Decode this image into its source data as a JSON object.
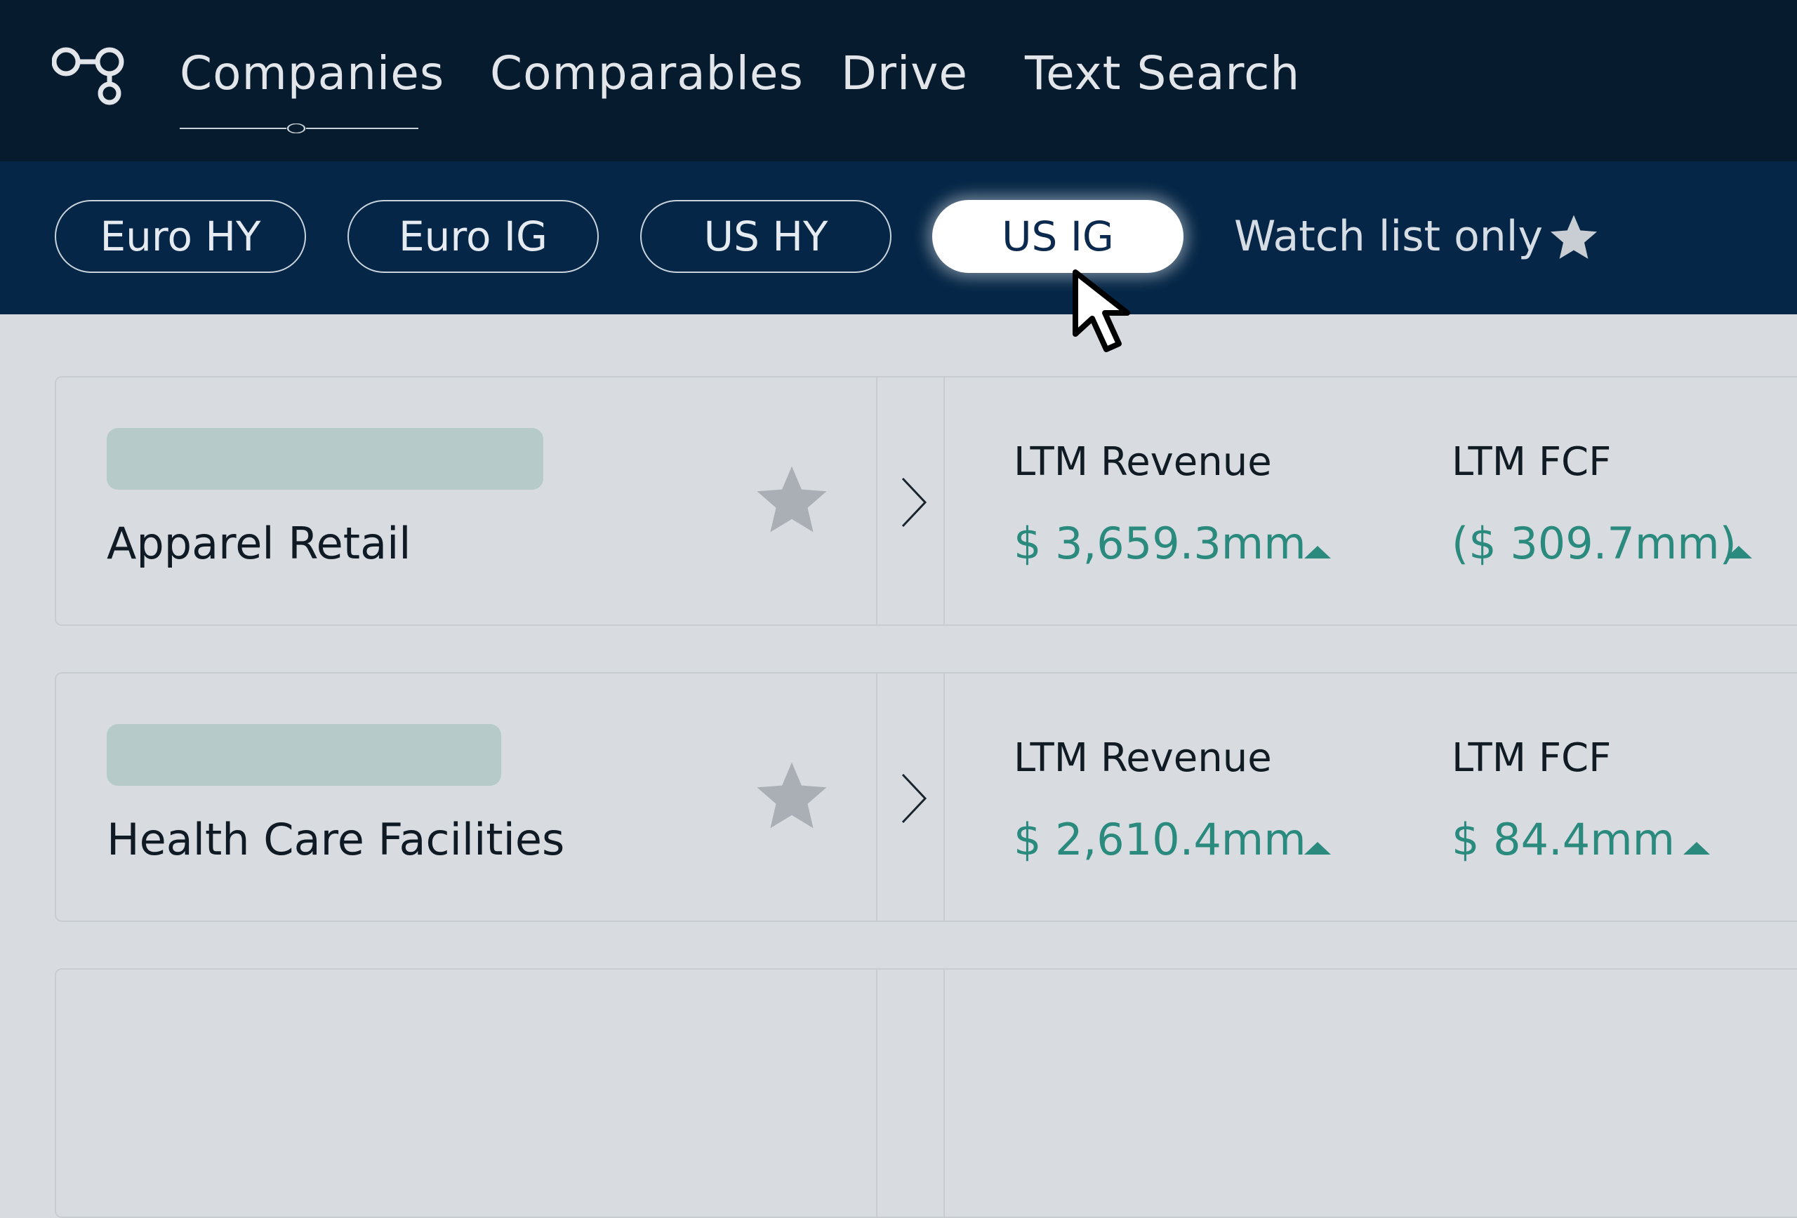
{
  "nav": {
    "items": [
      {
        "label": "Companies",
        "active": true
      },
      {
        "label": "Comparables",
        "active": false
      },
      {
        "label": "Drive",
        "active": false
      },
      {
        "label": "Text Search",
        "active": false
      }
    ]
  },
  "filters": {
    "pills": [
      {
        "label": "Euro HY",
        "active": false
      },
      {
        "label": "Euro IG",
        "active": false
      },
      {
        "label": "US HY",
        "active": false
      },
      {
        "label": "US IG",
        "active": true
      }
    ],
    "watch_list_label": "Watch list only",
    "watch_list_icon": "star-icon"
  },
  "companies": [
    {
      "sector": "Apparel Retail",
      "metrics": [
        {
          "label": "LTM Revenue",
          "value": "$ 3,659.3mm",
          "trend": "up"
        },
        {
          "label": "LTM FCF",
          "value": "($ 309.7mm)",
          "trend": "up"
        }
      ]
    },
    {
      "sector": "Health Care Facilities",
      "metrics": [
        {
          "label": "LTM Revenue",
          "value": "$ 2,610.4mm",
          "trend": "up"
        },
        {
          "label": "LTM FCF",
          "value": "$ 84.4mm",
          "trend": "up"
        }
      ]
    }
  ],
  "colors": {
    "top_nav_bg": "#061b2d",
    "filter_bar_bg": "#052646",
    "content_bg": "#d8dce0",
    "value_green": "#2a8a7e",
    "placeholder": "#b6cbc9"
  }
}
